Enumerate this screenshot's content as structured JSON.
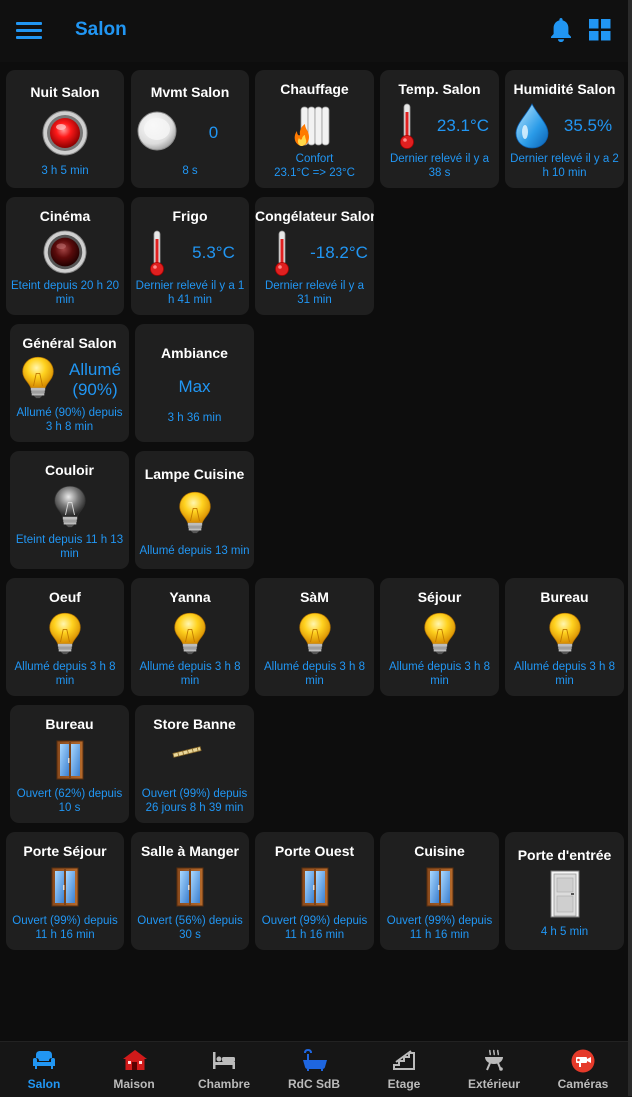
{
  "header": {
    "title": "Salon",
    "menu_icon": "hamburger-menu-icon",
    "bell_icon": "bell-icon",
    "grid_icon": "grid-icon",
    "accent": "#2196f3"
  },
  "tiles": {
    "nuit_salon": {
      "title": "Nuit Salon",
      "status": "3 h 5 min",
      "icon": "red-button-on-icon"
    },
    "mvmt_salon": {
      "title": "Mvmt Salon",
      "value": "0",
      "status": "8 s",
      "icon": "motion-sensor-icon"
    },
    "chauffage": {
      "title": "Chauffage",
      "status_line1": "Confort",
      "status_line2": "23.1°C => 23°C",
      "icon": "radiator-flame-icon"
    },
    "temp_salon": {
      "title": "Temp. Salon",
      "value": "23.1°C",
      "status": "Dernier relevé il y a 38 s",
      "icon": "thermometer-icon"
    },
    "humidite_salon": {
      "title": "Humidité Salon",
      "value": "35.5%",
      "status": "Dernier relevé il y a 2 h 10 min",
      "icon": "water-drop-icon"
    },
    "cinema": {
      "title": "Cinéma",
      "status": "Eteint depuis 20 h 20 min",
      "icon": "red-button-off-icon"
    },
    "frigo": {
      "title": "Frigo",
      "value": "5.3°C",
      "status": "Dernier relevé il y a 1 h 41 min",
      "icon": "thermometer-icon"
    },
    "congelateur": {
      "title": "Congélateur Salon",
      "value": "-18.2°C",
      "status": "Dernier relevé il y a 31 min",
      "icon": "thermometer-icon"
    },
    "general_salon": {
      "title": "Général Salon",
      "value_line1": "Allumé",
      "value_line2": "(90%)",
      "status": "Allumé (90%) depuis 3 h 8 min",
      "icon": "bulb-on-icon"
    },
    "ambiance": {
      "title": "Ambiance",
      "value": "Max",
      "status": "3 h 36 min"
    },
    "couloir": {
      "title": "Couloir",
      "status": "Eteint depuis 11 h 13 min",
      "icon": "bulb-off-icon"
    },
    "lampe_cuisine": {
      "title": "Lampe Cuisine",
      "status": "Allumé depuis 13 min",
      "icon": "bulb-on-icon"
    },
    "oeuf": {
      "title": "Oeuf",
      "status": "Allumé depuis 3 h 8 min",
      "icon": "bulb-on-icon"
    },
    "yanna": {
      "title": "Yanna",
      "status": "Allumé depuis 3 h 8 min",
      "icon": "bulb-on-icon"
    },
    "sam": {
      "title": "SàM",
      "status": "Allumé depuis 3 h 8 min",
      "icon": "bulb-on-icon"
    },
    "sejour": {
      "title": "Séjour",
      "status": "Allumé depuis 3 h 8 min",
      "icon": "bulb-on-icon"
    },
    "bureau_light": {
      "title": "Bureau",
      "status": "Allumé depuis 3 h 8 min",
      "icon": "bulb-on-icon"
    },
    "bureau_shutter": {
      "title": "Bureau",
      "status": "Ouvert (62%) depuis 10 s",
      "icon": "window-icon"
    },
    "store_banne": {
      "title": "Store Banne",
      "status": "Ouvert (99%) depuis 26 jours 8 h 39 min",
      "icon": "awning-icon"
    },
    "porte_sejour": {
      "title": "Porte Séjour",
      "status": "Ouvert (99%) depuis 11 h 16 min",
      "icon": "window-icon"
    },
    "salle_manger": {
      "title": "Salle à Manger",
      "status": "Ouvert (56%) depuis 30 s",
      "icon": "window-icon"
    },
    "porte_ouest": {
      "title": "Porte Ouest",
      "status": "Ouvert (99%) depuis 11 h 16 min",
      "icon": "window-icon"
    },
    "cuisine": {
      "title": "Cuisine",
      "status": "Ouvert (99%) depuis 11 h 16 min",
      "icon": "window-icon"
    },
    "porte_entree": {
      "title": "Porte d'entrée",
      "status": "4 h 5 min",
      "icon": "door-icon"
    }
  },
  "nav": {
    "salon": {
      "label": "Salon",
      "icon": "sofa-icon",
      "active": true
    },
    "maison": {
      "label": "Maison",
      "icon": "house-icon"
    },
    "chambre": {
      "label": "Chambre",
      "icon": "bed-icon"
    },
    "rdc_sdb": {
      "label": "RdC SdB",
      "icon": "bathtub-icon"
    },
    "etage": {
      "label": "Etage",
      "icon": "stairs-icon"
    },
    "exterieur": {
      "label": "Extérieur",
      "icon": "barbecue-icon"
    },
    "cameras": {
      "label": "Caméras",
      "icon": "camera-icon"
    }
  }
}
